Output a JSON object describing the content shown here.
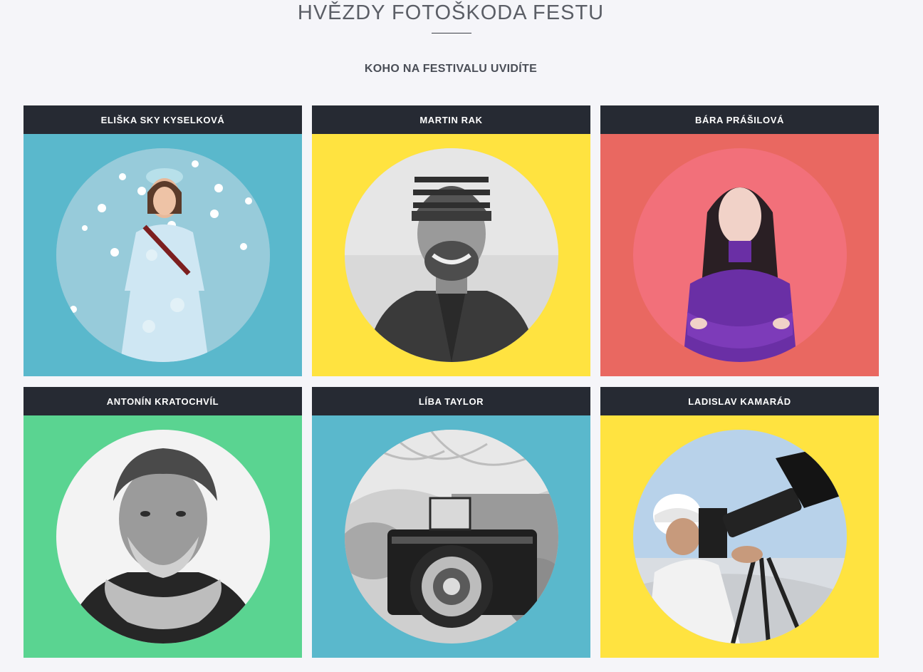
{
  "header": {
    "title": "HVĚZDY FOTOŠKODA FESTU",
    "subtitle": "KOHO NA FESTIVALU UVIDÍTE"
  },
  "cards": [
    {
      "name": "ELIŠKA SKY KYSELKOVÁ",
      "bg": "#5ab8cc",
      "photo": "portrait-photo"
    },
    {
      "name": "MARTIN RAK",
      "bg": "#ffe340",
      "photo": "portrait-photo"
    },
    {
      "name": "BÁRA PRÁŠILOVÁ",
      "bg": "#e96861",
      "photo": "portrait-photo"
    },
    {
      "name": "ANTONÍN KRATOCHVÍL",
      "bg": "#5ad491",
      "photo": "portrait-photo"
    },
    {
      "name": "LÍBA TAYLOR",
      "bg": "#5ab8cc",
      "photo": "portrait-photo"
    },
    {
      "name": "LADISLAV KAMARÁD",
      "bg": "#ffe340",
      "photo": "portrait-photo"
    }
  ]
}
